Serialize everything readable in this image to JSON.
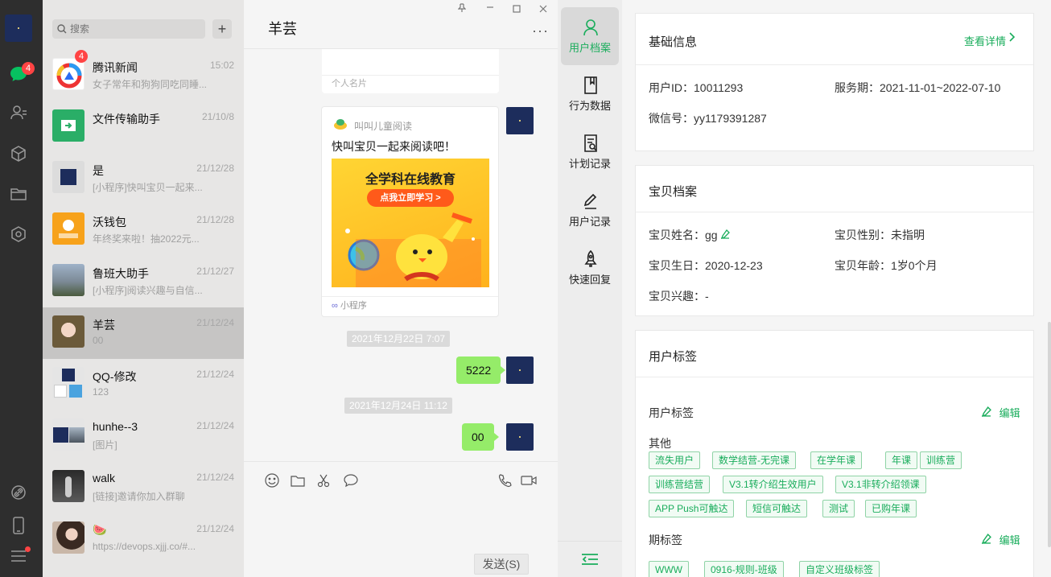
{
  "nav": {
    "badge": "4"
  },
  "search": {
    "placeholder": "搜索"
  },
  "conversations": [
    {
      "name": "腾讯新闻",
      "time": "15:02",
      "preview": "女子常年和狗狗同吃同睡...",
      "badge": "4"
    },
    {
      "name": "文件传输助手",
      "time": "21/10/8",
      "preview": ""
    },
    {
      "name": "是",
      "time": "21/12/28",
      "preview": "[小程序]快叫宝贝一起来..."
    },
    {
      "name": "沃钱包",
      "time": "21/12/28",
      "preview": "年终奖来啦！抽2022元..."
    },
    {
      "name": "鲁班大助手",
      "time": "21/12/27",
      "preview": "[小程序]阅读兴趣与自信..."
    },
    {
      "name": "羊芸",
      "time": "21/12/24",
      "preview": "00"
    },
    {
      "name": "QQ-修改",
      "time": "21/12/24",
      "preview": "123"
    },
    {
      "name": "hunhe--3",
      "time": "21/12/24",
      "preview": "[图片]"
    },
    {
      "name": "walk",
      "time": "21/12/24",
      "preview": "[链接]邀请你加入群聊"
    },
    {
      "name": "🍉",
      "time": "21/12/24",
      "preview": "https://devops.xjjj.co/#..."
    }
  ],
  "chat": {
    "title": "羊芸",
    "card_label": "个人名片",
    "mini": {
      "source": "叫叫儿童阅读",
      "title": "快叫宝贝一起来阅读吧！",
      "banner_title": "全学科在线教育",
      "banner_button": "点我立即学习 >",
      "footer": "小程序"
    },
    "messages": [
      {
        "time": "2021年12月22日 7:07",
        "text": "5222"
      },
      {
        "time": "2021年12月24日 11:12",
        "text": "00"
      }
    ],
    "send_label": "发送(S)"
  },
  "tabs": [
    {
      "label": "用户档案",
      "icon": "user-icon"
    },
    {
      "label": "行为数据",
      "icon": "bookmark-icon"
    },
    {
      "label": "计划记录",
      "icon": "plan-icon"
    },
    {
      "label": "用户记录",
      "icon": "pen-icon"
    },
    {
      "label": "快速回复",
      "icon": "rocket-icon"
    }
  ],
  "profile": {
    "basic": {
      "title": "基础信息",
      "detail_link": "查看详情",
      "user_id": "用户ID：10011293",
      "service": "服务期：2021-11-01~2022-07-10",
      "wechat": "微信号：yy1179391287"
    },
    "baby": {
      "title": "宝贝档案",
      "name": "宝贝姓名：gg",
      "gender": "宝贝性别：未指明",
      "birthday": "宝贝生日：2020-12-23",
      "age": "宝贝年龄：1岁0个月",
      "interest": "宝贝兴趣：-"
    },
    "tags": {
      "title": "用户标签",
      "sub_title": "用户标签",
      "edit_label": "编辑",
      "group_other": "其他",
      "other_tags": [
        "流失用户",
        "数学结营-无完课",
        "在学年课",
        "年课",
        "训练营",
        "训练营结营",
        "V3.1转介绍生效用户",
        "V3.1非转介绍领课",
        "APP Push可触达",
        "短信可触达",
        "测试",
        "已购年课"
      ],
      "period_title": "期标签",
      "period_edit": "编辑",
      "period_tags": [
        "WWW",
        "0916-规则-班级",
        "自定义班级标签"
      ]
    }
  },
  "colors": {
    "accent": "#1aad5c",
    "bubble": "#95ec69",
    "badge": "#ff4444"
  }
}
